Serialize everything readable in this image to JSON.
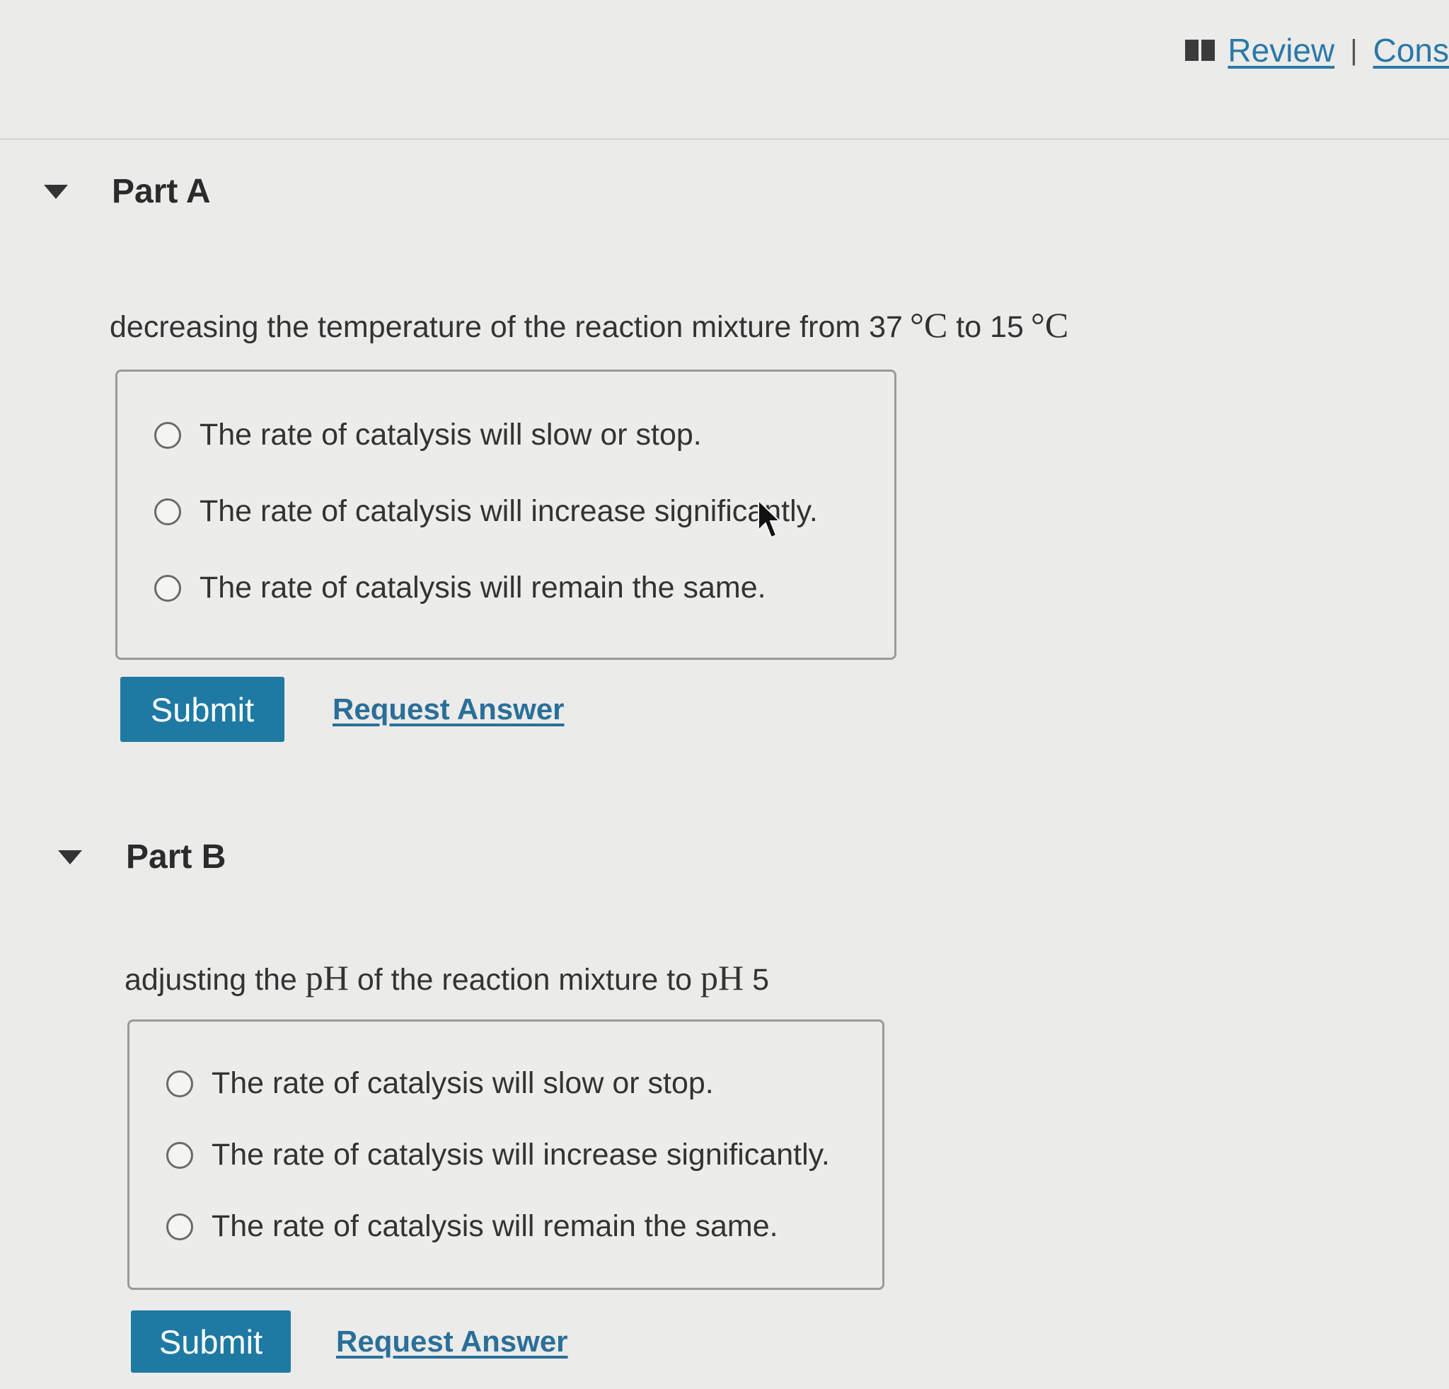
{
  "header": {
    "review_label": "Review",
    "separator": "|",
    "constants_label": "Cons",
    "book_icon": "book-icon"
  },
  "parts": [
    {
      "title": "Part A",
      "question_prefix": "decreasing the temperature of the reaction mixture from 37",
      "question_deg1": "°C",
      "question_mid": " to 15",
      "question_deg2": "°C",
      "options": [
        "The rate of catalysis will slow or stop.",
        "The rate of catalysis will increase significantly.",
        "The rate of catalysis will remain the same."
      ],
      "submit_label": "Submit",
      "request_label": "Request Answer"
    },
    {
      "title": "Part B",
      "question_prefix": "adjusting the ",
      "question_ph1": "pH",
      "question_mid": " of the reaction mixture to ",
      "question_ph2": "pH",
      "question_suffix": " 5",
      "options": [
        "The rate of catalysis will slow or stop.",
        "The rate of catalysis will increase significantly.",
        "The rate of catalysis will remain the same."
      ],
      "submit_label": "Submit",
      "request_label": "Request Answer"
    }
  ]
}
